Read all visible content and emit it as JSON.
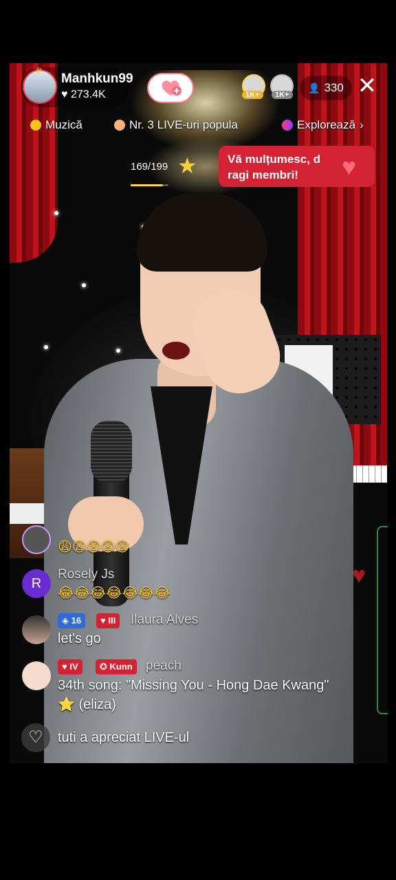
{
  "host": {
    "name": "Manhkun99",
    "likes": "273.4K",
    "heart_icon": "heart-icon"
  },
  "top_viewers": [
    {
      "badge": "1K+"
    },
    {
      "badge": "1K+"
    }
  ],
  "viewer_count": "330",
  "tags": {
    "category": "Muzică",
    "ranking": "Nr. 3 LIVE-uri popula",
    "explore": "Explorează"
  },
  "goal": {
    "progress_text": "169/199",
    "current": 169,
    "target": 199
  },
  "gift_banner": {
    "text": "Vă mulțumesc, d ragi membri!"
  },
  "comments": [
    {
      "text": "😩😩😩😩😩"
    },
    {
      "avatar_letter": "R",
      "name": "Rosely Js",
      "text": "😂😂😂😂😂😂😂"
    },
    {
      "badges": [
        "16",
        "III"
      ],
      "name": "Ilaura Alves",
      "text": "let's go"
    },
    {
      "badges": [
        "IV",
        "Kunn"
      ],
      "name": "peach",
      "text_line1": "34th song: \"Missing You - Hong Dae Kwang\"",
      "text_line2": "⭐ (eliza)"
    }
  ],
  "like_notice": {
    "text": "tuti a apreciat LIVE-ul"
  },
  "colors": {
    "accent_red": "#d42235",
    "gold": "#ffd54a"
  }
}
